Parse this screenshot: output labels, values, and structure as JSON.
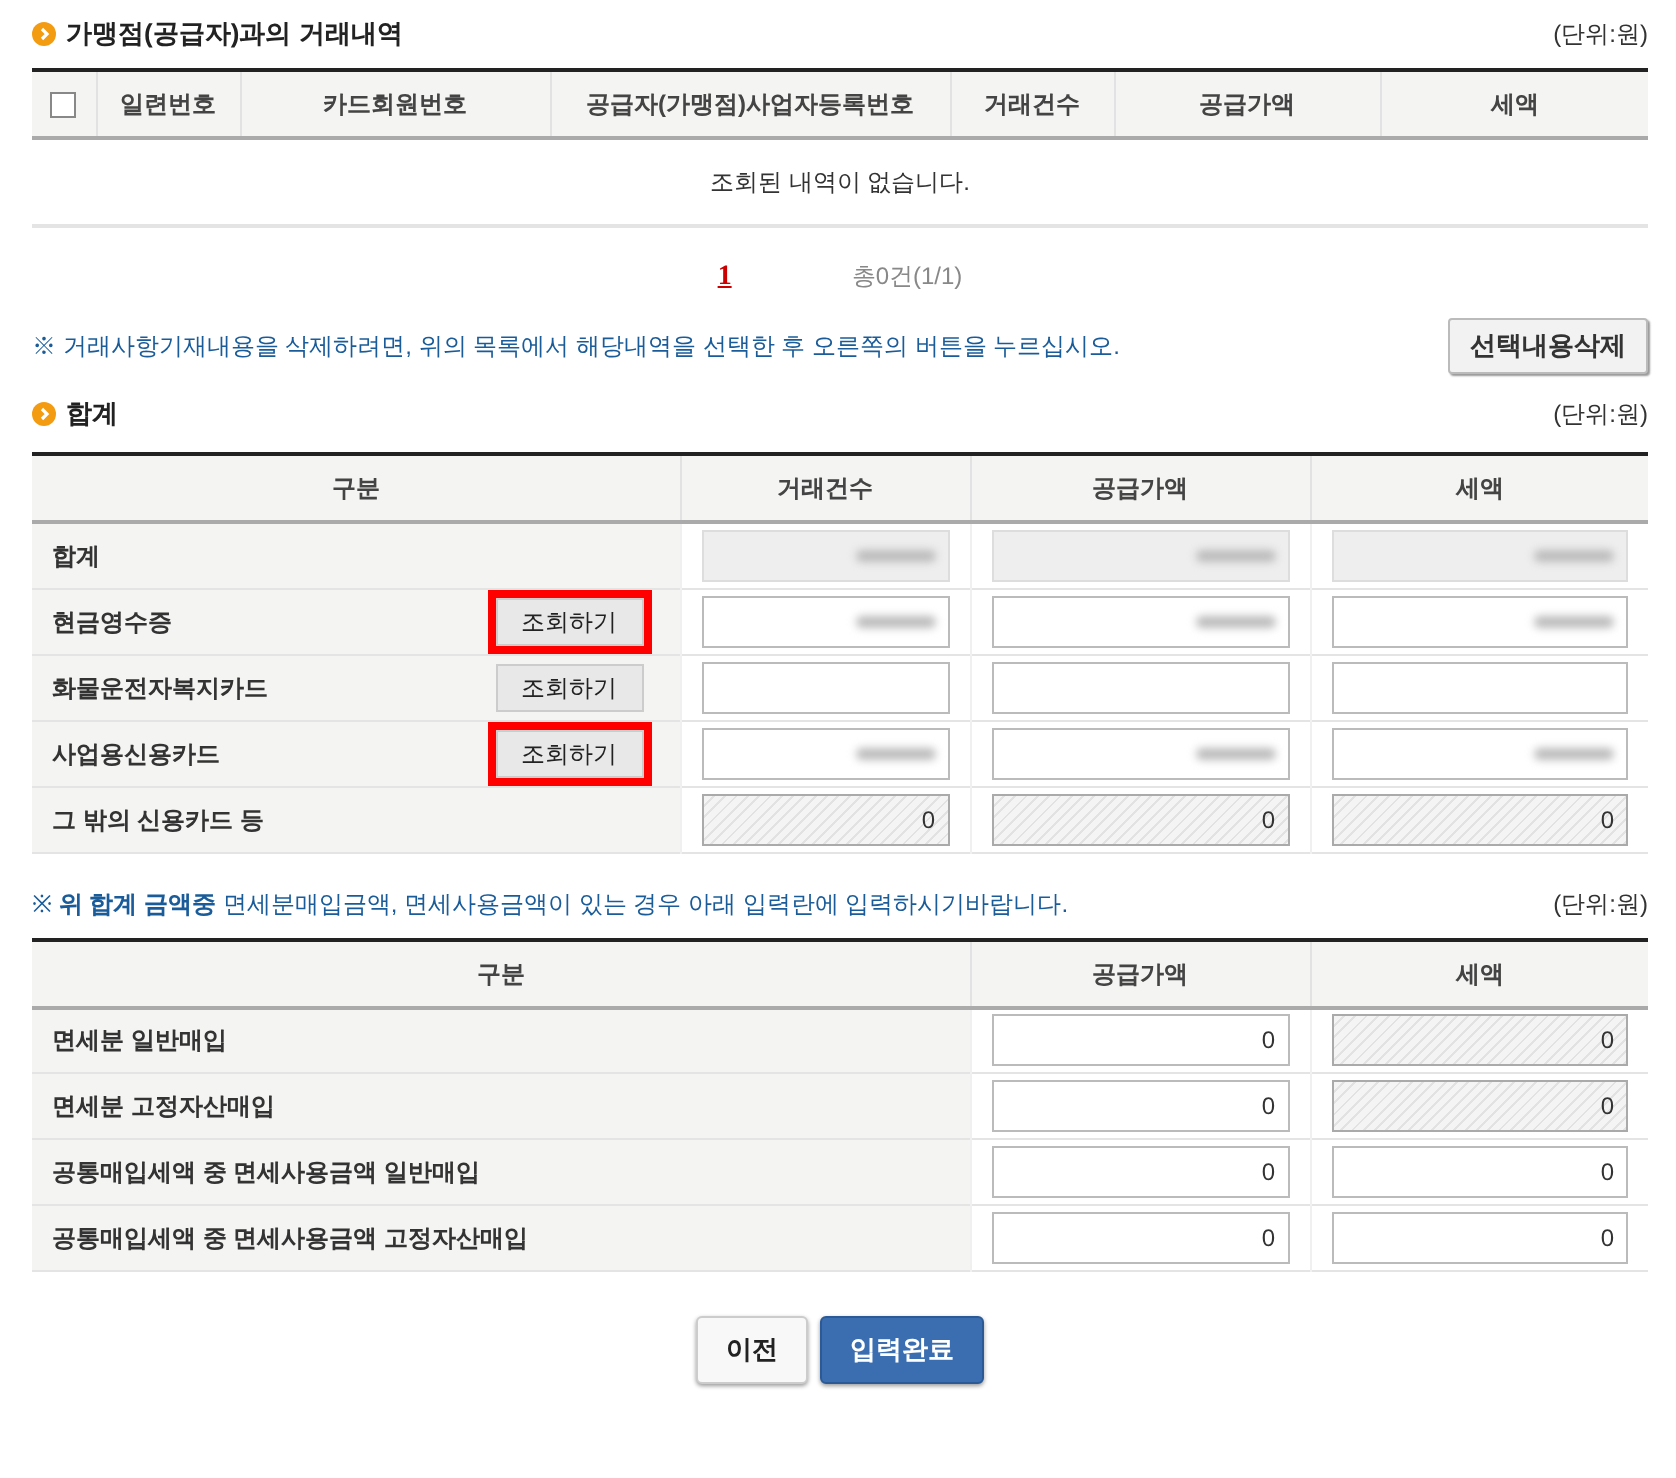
{
  "transactions": {
    "title": "가맹점(공급자)과의 거래내역",
    "unit": "(단위:원)",
    "select_all": {
      "checked": false
    },
    "columns": [
      "일련번호",
      "카드회원번호",
      "공급자(가맹점)사업자등록번호",
      "거래건수",
      "공급가액",
      "세액"
    ],
    "empty_message": "조회된 내역이 없습니다.",
    "pagination": {
      "pages": [
        {
          "label": "1",
          "selected": true
        }
      ],
      "total": "총0건(1/1)"
    },
    "note": "※ 거래사항기재내용을 삭제하려면, 위의 목록에서 해당내역을 선택한 후 오른쪽의 버튼을 누르십시오.",
    "delete_button": "선택내용삭제"
  },
  "summary": {
    "title": "합계",
    "unit": "(단위:원)",
    "columns": [
      "구분",
      "거래건수",
      "공급가액",
      "세액"
    ],
    "rows": [
      {
        "label": "합계",
        "fields": [
          {
            "kind": "readonly",
            "redacted": true
          },
          {
            "kind": "readonly",
            "redacted": true
          },
          {
            "kind": "readonly",
            "redacted": true
          }
        ]
      },
      {
        "label": "현금영수증",
        "button": {
          "label": "조회하기",
          "highlighted": true
        },
        "fields": [
          {
            "kind": "input",
            "redacted": true
          },
          {
            "kind": "input",
            "redacted": true
          },
          {
            "kind": "input",
            "redacted": true
          }
        ]
      },
      {
        "label": "화물운전자복지카드",
        "button": {
          "label": "조회하기",
          "highlighted": false
        },
        "fields": [
          {
            "kind": "input",
            "redacted": false
          },
          {
            "kind": "input",
            "redacted": false
          },
          {
            "kind": "input",
            "redacted": false
          }
        ]
      },
      {
        "label": "사업용신용카드",
        "button": {
          "label": "조회하기",
          "highlighted": true
        },
        "fields": [
          {
            "kind": "input",
            "redacted": true
          },
          {
            "kind": "input",
            "redacted": true
          },
          {
            "kind": "input",
            "redacted": true
          }
        ]
      },
      {
        "label": "그 밖의 신용카드 등",
        "fields": [
          {
            "kind": "disabled",
            "value": "0",
            "redacted": false
          },
          {
            "kind": "disabled",
            "value": "0",
            "redacted": false
          },
          {
            "kind": "disabled",
            "value": "0",
            "redacted": false
          }
        ]
      }
    ]
  },
  "tax_free": {
    "note": "※ **위 합계 금액중** 면세분매입금액, 면세사용금액이 있는 경우 아래 입력란에 입력하시기바랍니다.",
    "unit": "(단위:원)",
    "columns": [
      "구분",
      "공급가액",
      "세액"
    ],
    "rows": [
      {
        "label": "면세분 일반매입",
        "fields": [
          {
            "kind": "input",
            "value": "0"
          },
          {
            "kind": "disabled",
            "value": "0"
          }
        ]
      },
      {
        "label": "면세분 고정자산매입",
        "fields": [
          {
            "kind": "input",
            "value": "0"
          },
          {
            "kind": "disabled",
            "value": "0"
          }
        ]
      },
      {
        "label": "공통매입세액 중 면세사용금액 일반매입",
        "fields": [
          {
            "kind": "input",
            "value": "0"
          },
          {
            "kind": "input",
            "value": "0"
          }
        ]
      },
      {
        "label": "공통매입세액 중 면세사용금액 고정자산매입",
        "fields": [
          {
            "kind": "input",
            "value": "0"
          },
          {
            "kind": "input",
            "value": "0"
          }
        ]
      }
    ]
  },
  "buttons": [
    {
      "label": "이전",
      "kind": "secondary"
    },
    {
      "label": "입력완료",
      "kind": "primary"
    }
  ]
}
